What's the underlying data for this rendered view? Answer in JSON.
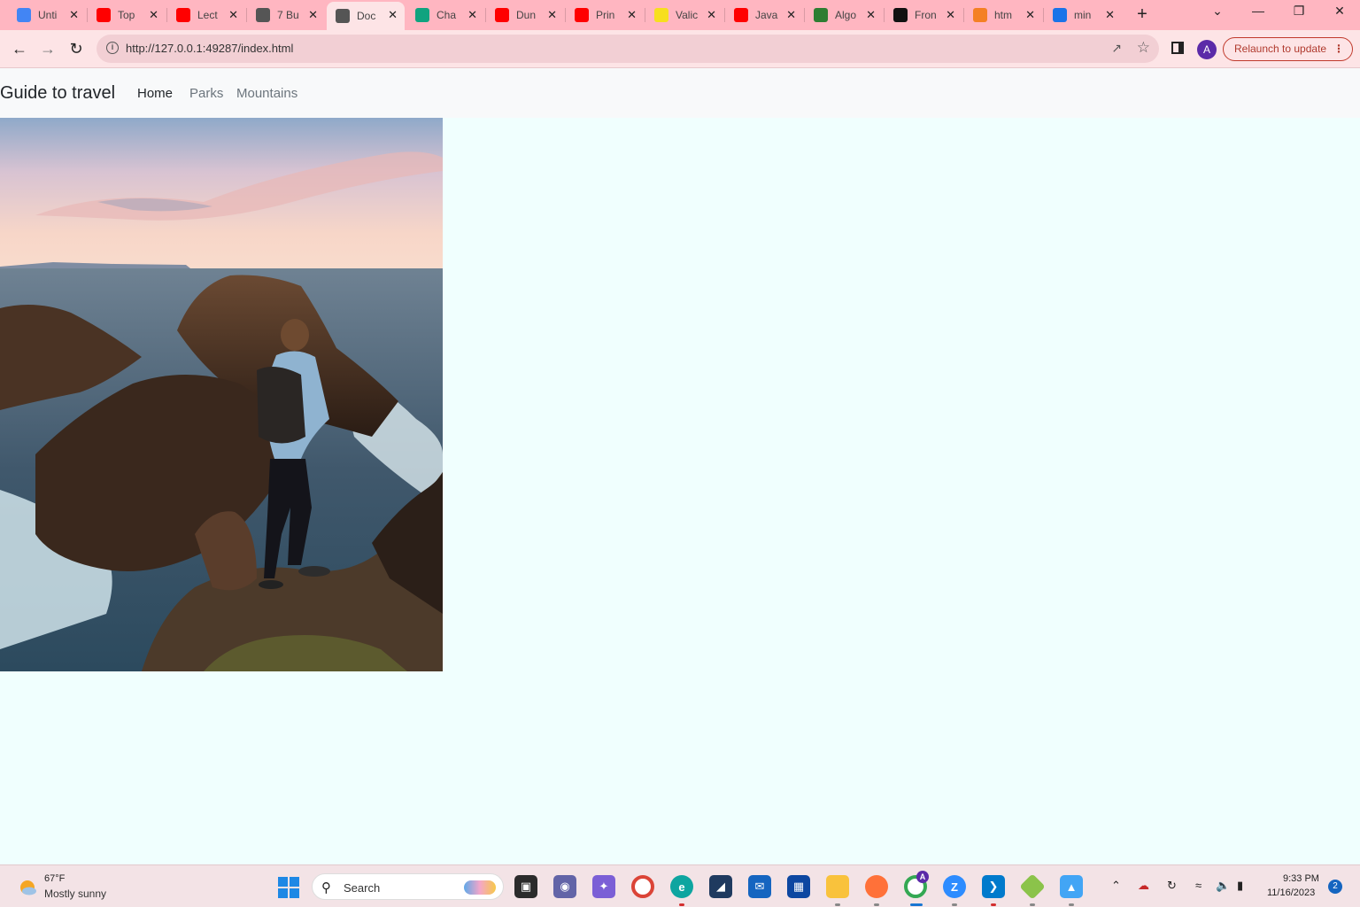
{
  "browser": {
    "tabs": [
      {
        "label": "Unti",
        "icon": "google-docs-icon",
        "color": "#4285f4"
      },
      {
        "label": "Top",
        "icon": "youtube-icon",
        "color": "#ff0000"
      },
      {
        "label": "Lect",
        "icon": "youtube-icon",
        "color": "#ff0000"
      },
      {
        "label": "7 Bu",
        "icon": "tab-icon",
        "color": "#555555"
      },
      {
        "label": "Doc",
        "icon": "document-icon",
        "color": "#555555",
        "active": true
      },
      {
        "label": "Cha",
        "icon": "chatgpt-icon",
        "color": "#10a37f"
      },
      {
        "label": "Dun",
        "icon": "youtube-icon",
        "color": "#ff0000"
      },
      {
        "label": "Prin",
        "icon": "youtube-icon",
        "color": "#ff0000"
      },
      {
        "label": "Valic",
        "icon": "js-icon",
        "color": "#f7df1e"
      },
      {
        "label": "Java",
        "icon": "youtube-icon",
        "color": "#ff0000"
      },
      {
        "label": "Algo",
        "icon": "algo-icon",
        "color": "#2e7d32"
      },
      {
        "label": "Fron",
        "icon": "medium-icon",
        "color": "#111111"
      },
      {
        "label": "htm",
        "icon": "stackoverflow-icon",
        "color": "#f48024"
      },
      {
        "label": "min",
        "icon": "search-icon",
        "color": "#1a73e8"
      }
    ],
    "new_tab": "+",
    "url": "http://127.0.0.1:49287/index.html",
    "profile_initial": "A",
    "relaunch_label": "Relaunch to update"
  },
  "page": {
    "brand": "Guide to travel",
    "nav": [
      {
        "label": "Home",
        "active": true
      },
      {
        "label": "Parks",
        "active": false
      },
      {
        "label": "Mountains",
        "active": false
      }
    ],
    "hero_alt": "traveler-on-coastal-cliff-photo"
  },
  "taskbar": {
    "weather_temp": "67°F",
    "weather_desc": "Mostly sunny",
    "search_label": "Search",
    "time": "9:33 PM",
    "date": "11/16/2023",
    "notifications": "2",
    "profile_badge": "A"
  },
  "colors": {
    "tab_strip": "#ffb6c1",
    "toolbar": "#fde4e6",
    "page_bg": "#f0fffe",
    "navbar_bg": "#f8f9fa"
  }
}
